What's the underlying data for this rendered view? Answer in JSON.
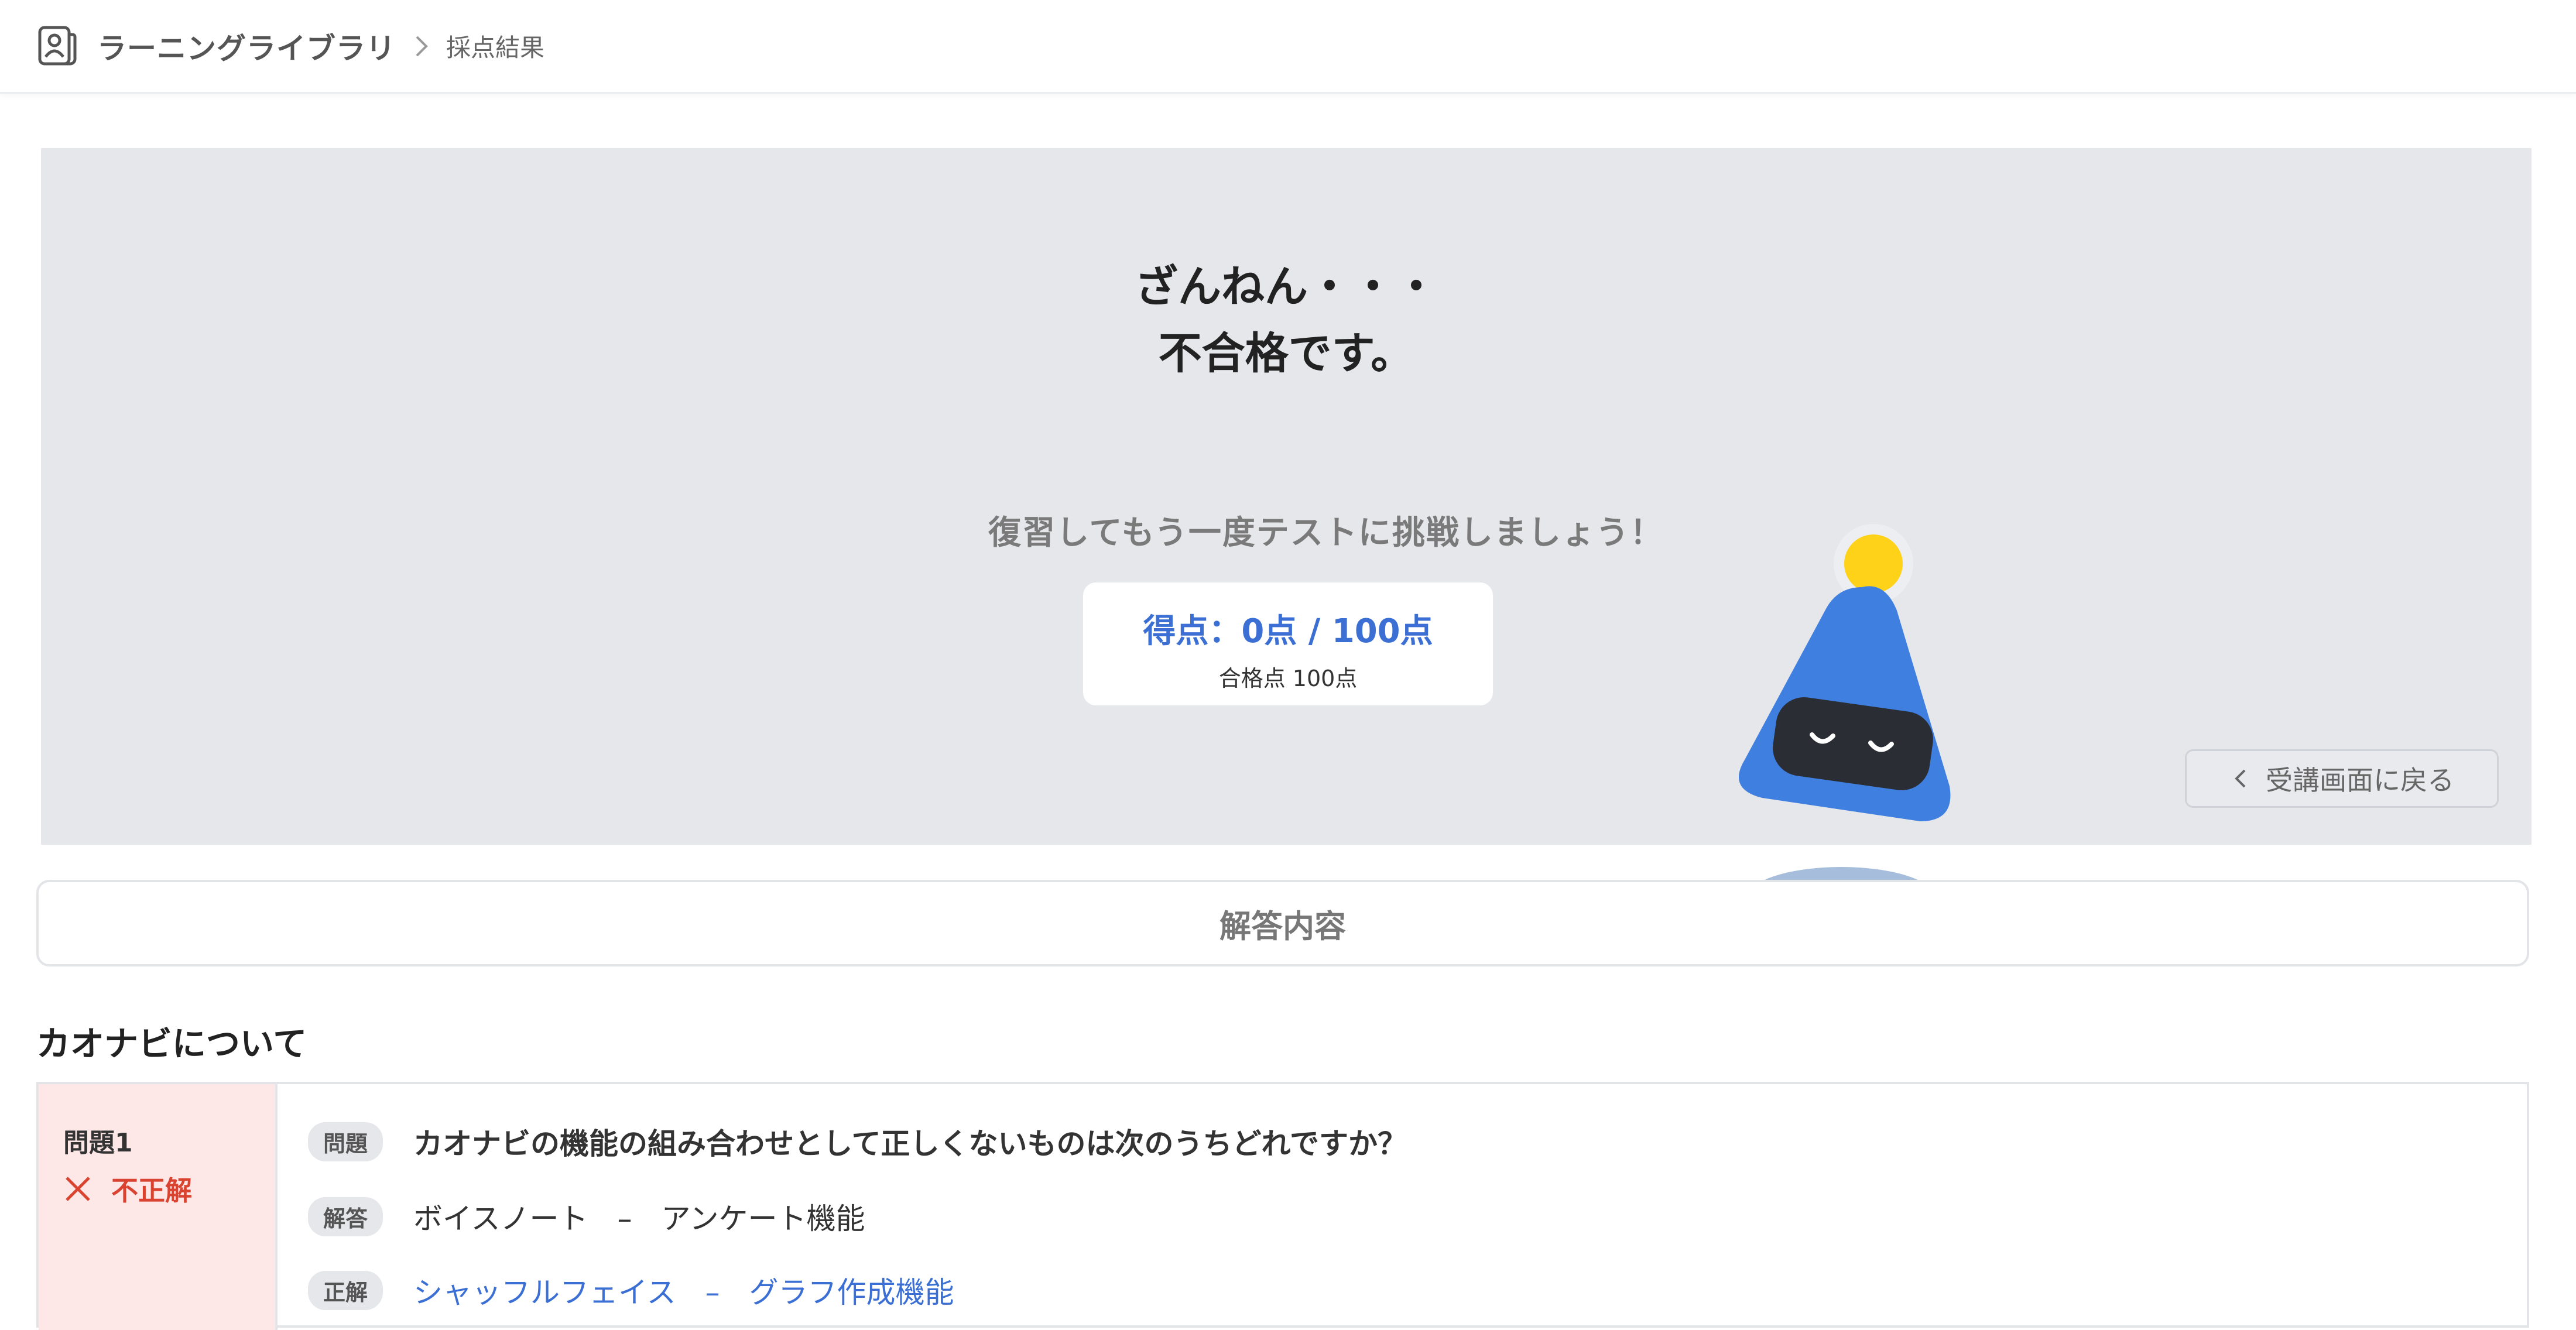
{
  "header": {
    "title": "ラーニングライブラリ",
    "breadcrumb": "採点結果"
  },
  "result": {
    "title_line1": "ざんねん・・・",
    "title_line2": "不合格です。",
    "subtitle": "復習してもう一度テストに挑戦しましょう！",
    "score": "得点：0点 / 100点",
    "passing": "合格点 100点",
    "back_button": "受講画面に戻る"
  },
  "answers": {
    "heading": "解答内容",
    "section": "カオナビについて",
    "question": {
      "number": "問題1",
      "status": "不正解",
      "question_tag": "問題",
      "question_text": "カオナビの機能の組み合わせとして正しくないものは次のうちどれですか？",
      "answer_tag": "解答",
      "answer_text": "ボイスノート　–　アンケート機能",
      "correct_tag": "正解",
      "correct_text": "シャッフルフェイス　–　グラフ作成機能"
    }
  },
  "colors": {
    "accent": "#3b6fd4",
    "error": "#d9432f",
    "hero_bg": "#e6e7eb",
    "mascot_body": "#3f7fe0",
    "mascot_bulb": "#ffd21a"
  }
}
